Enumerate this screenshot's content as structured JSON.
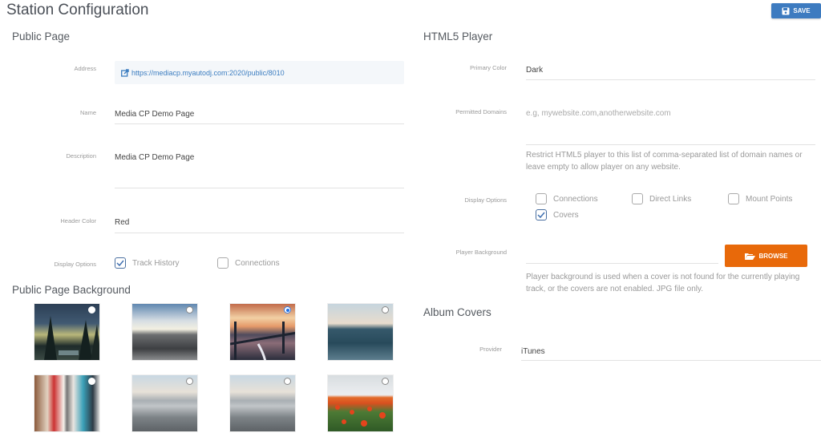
{
  "page_title": "Station Configuration",
  "save_button": {
    "label": "SAVE",
    "icon": "floppy-disk-icon",
    "color": "#3d7bc0"
  },
  "public_page": {
    "title": "Public Page",
    "address": {
      "label": "Address",
      "value": "https://mediacp.myautodj.com:2020/public/8010",
      "icon": "external-link-icon"
    },
    "name": {
      "label": "Name",
      "value": "Media CP Demo Page"
    },
    "description": {
      "label": "Description",
      "value": "Media CP Demo Page"
    },
    "header_color": {
      "label": "Header Color",
      "value": "Red"
    },
    "display_options": {
      "label": "Display Options",
      "options": [
        {
          "label": "Track History",
          "checked": true
        },
        {
          "label": "Connections",
          "checked": false
        }
      ]
    }
  },
  "public_page_background": {
    "title": "Public Page Background",
    "images": [
      {
        "name": "night-forest-milky-way",
        "selected": false
      },
      {
        "name": "rocky-coast-sunset",
        "selected": false
      },
      {
        "name": "bridge-sunset-river",
        "selected": true
      },
      {
        "name": "ocean-waves",
        "selected": false
      },
      {
        "name": "poster-collage-wall",
        "selected": false
      },
      {
        "name": "misty-mountains",
        "selected": false
      },
      {
        "name": "misty-mountains-2",
        "selected": false
      },
      {
        "name": "poppy-field",
        "selected": false
      }
    ]
  },
  "html5_player": {
    "title": "HTML5 Player",
    "primary_color": {
      "label": "Primary Color",
      "value": "Dark"
    },
    "permitted_domains": {
      "label": "Permitted Domains",
      "placeholder": "e.g, mywebsite.com,anotherwebsite.com",
      "value": "",
      "help": "Restrict HTML5 player to this list of comma-separated list of domain names or leave empty to allow player on any website."
    },
    "display_options": {
      "label": "Display Options",
      "options": [
        {
          "label": "Connections",
          "checked": false
        },
        {
          "label": "Direct Links",
          "checked": false
        },
        {
          "label": "Mount Points",
          "checked": false
        },
        {
          "label": "Covers",
          "checked": true
        }
      ]
    },
    "player_background": {
      "label": "Player Background",
      "value": "",
      "browse_label": "BROWSE",
      "browse_icon": "folder-open-icon",
      "browse_color": "#e8690a",
      "help": "Player background is used when a cover is not found for the currently playing track, or the covers are not enabled. JPG file only."
    }
  },
  "album_covers": {
    "title": "Album Covers",
    "provider": {
      "label": "Provider",
      "value": "iTunes"
    }
  }
}
